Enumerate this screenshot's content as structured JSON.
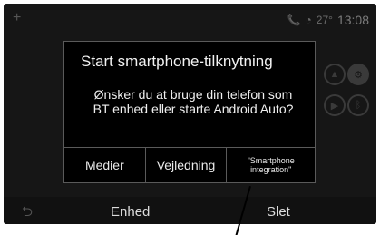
{
  "statusbar": {
    "clock": "13:08",
    "temp": "27°",
    "icons": [
      "phone-icon",
      "signal-icon"
    ]
  },
  "dialog": {
    "title": "Start smartphone-tilknytning",
    "body_line1": "Ønsker du at bruge din telefon som",
    "body_line2": "BT enhed eller starte Android Auto?",
    "buttons": {
      "media": "Medier",
      "guide": "Vejledning",
      "smartphone_line1": "\"Smartphone",
      "smartphone_line2": "integration\""
    }
  },
  "bottom_bar": {
    "device": "Enhed",
    "delete": "Slet"
  }
}
